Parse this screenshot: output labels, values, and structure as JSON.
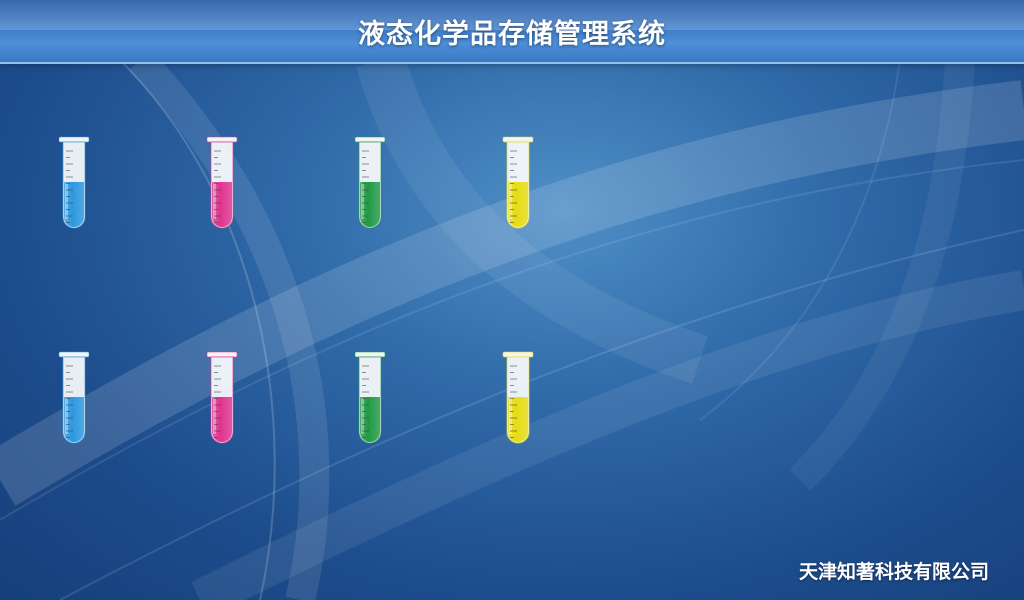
{
  "header": {
    "title": "液态化学品存储管理系统"
  },
  "footer": {
    "company": "天津知著科技有限公司"
  },
  "tubes": [
    {
      "id": "tube-1",
      "color": "#2c97e0",
      "icon": "test-tube-icon"
    },
    {
      "id": "tube-2",
      "color": "#e0338e",
      "icon": "test-tube-icon"
    },
    {
      "id": "tube-3",
      "color": "#1f9a45",
      "icon": "test-tube-icon"
    },
    {
      "id": "tube-4",
      "color": "#e8dc10",
      "icon": "test-tube-icon"
    },
    {
      "id": "tube-5",
      "color": "#2c97e0",
      "icon": "test-tube-icon"
    },
    {
      "id": "tube-6",
      "color": "#e0338e",
      "icon": "test-tube-icon"
    },
    {
      "id": "tube-7",
      "color": "#1f9a45",
      "icon": "test-tube-icon"
    },
    {
      "id": "tube-8",
      "color": "#e8dc10",
      "icon": "test-tube-icon"
    }
  ],
  "colors": {
    "title_bar": "#3e7cc8",
    "background": "#2f69a8",
    "text": "#ffffff"
  }
}
